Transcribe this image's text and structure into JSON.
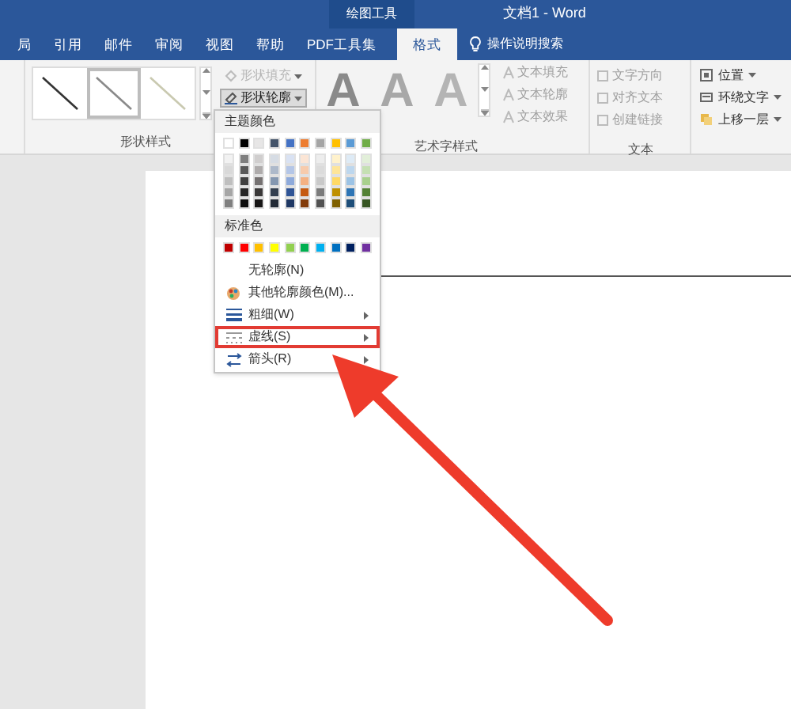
{
  "title_bar": {
    "context_tab": "绘图工具",
    "title": "文档1 - Word"
  },
  "tabs": [
    {
      "label": "局",
      "selected": false
    },
    {
      "label": "引用",
      "selected": false
    },
    {
      "label": "邮件",
      "selected": false
    },
    {
      "label": "审阅",
      "selected": false
    },
    {
      "label": "视图",
      "selected": false
    },
    {
      "label": "帮助",
      "selected": false
    },
    {
      "label": "PDF工具集",
      "selected": false
    },
    {
      "label": "格式",
      "selected": true
    }
  ],
  "tell_me": "操作说明搜索",
  "shape_styles": {
    "label": "形状样式",
    "thumbnails": [
      {
        "selected": false
      },
      {
        "selected": true
      },
      {
        "selected": false
      }
    ],
    "buttons": [
      {
        "label": "形状填充",
        "disabled": true,
        "active": false
      },
      {
        "label": "形状轮廓",
        "disabled": false,
        "active": true
      }
    ]
  },
  "wordart_styles": {
    "label": "艺术字样式",
    "letters": [
      "A",
      "A",
      "A"
    ],
    "buttons": [
      {
        "label": "文本填充"
      },
      {
        "label": "文本轮廓"
      },
      {
        "label": "文本效果"
      }
    ]
  },
  "text_group": {
    "label": "文本",
    "buttons": [
      {
        "label": "文字方向"
      },
      {
        "label": "对齐文本"
      },
      {
        "label": "创建链接"
      }
    ]
  },
  "arrange": [
    {
      "label": "位置"
    },
    {
      "label": "环绕文字"
    },
    {
      "label": "上移一层"
    }
  ],
  "outline_menu": {
    "theme_header": "主题颜色",
    "theme_rows": [
      [
        {
          "color": "#ffffff"
        },
        {
          "color": "#000000"
        },
        {
          "color": "#e7e6e6"
        },
        {
          "color": "#44546a"
        },
        {
          "color": "#4472c4"
        },
        {
          "color": "#ed7d31"
        },
        {
          "color": "#a5a5a5"
        },
        {
          "color": "#ffc000"
        },
        {
          "color": "#5b9bd5"
        },
        {
          "color": "#70ad47"
        }
      ],
      [
        {
          "color": "#f2f2f2"
        },
        {
          "color": "#7f7f7f"
        },
        {
          "color": "#d0cece"
        },
        {
          "color": "#d6dce4"
        },
        {
          "color": "#d9e2f3"
        },
        {
          "color": "#fbe5d5"
        },
        {
          "color": "#ededed"
        },
        {
          "color": "#fff2cc"
        },
        {
          "color": "#deebf6"
        },
        {
          "color": "#e2efd9"
        }
      ],
      [
        {
          "color": "#d9d9d9"
        },
        {
          "color": "#595959"
        },
        {
          "color": "#aeabab"
        },
        {
          "color": "#adb9ca"
        },
        {
          "color": "#b4c6e7"
        },
        {
          "color": "#f7cbac"
        },
        {
          "color": "#dbdbdb"
        },
        {
          "color": "#fee599"
        },
        {
          "color": "#bdd7ee"
        },
        {
          "color": "#c5e0b3"
        }
      ],
      [
        {
          "color": "#bfbfbf"
        },
        {
          "color": "#404040"
        },
        {
          "color": "#757171"
        },
        {
          "color": "#8497b0"
        },
        {
          "color": "#8eaadb"
        },
        {
          "color": "#f4b183"
        },
        {
          "color": "#c9c9c9"
        },
        {
          "color": "#ffd965"
        },
        {
          "color": "#9cc3e5"
        },
        {
          "color": "#a8d08d"
        }
      ],
      [
        {
          "color": "#a6a6a6"
        },
        {
          "color": "#262626"
        },
        {
          "color": "#3a3838"
        },
        {
          "color": "#333f4f"
        },
        {
          "color": "#2f5496"
        },
        {
          "color": "#c55a11"
        },
        {
          "color": "#7b7b7b"
        },
        {
          "color": "#bf9000"
        },
        {
          "color": "#2e75b5"
        },
        {
          "color": "#538135"
        }
      ],
      [
        {
          "color": "#808080"
        },
        {
          "color": "#0d0d0d"
        },
        {
          "color": "#171616"
        },
        {
          "color": "#222a35"
        },
        {
          "color": "#1f3864"
        },
        {
          "color": "#833c0b"
        },
        {
          "color": "#525252"
        },
        {
          "color": "#7f6000"
        },
        {
          "color": "#1e4e79"
        },
        {
          "color": "#375623"
        }
      ]
    ],
    "standard_header": "标准色",
    "standard_colors": [
      {
        "color": "#c00000"
      },
      {
        "color": "#ff0000"
      },
      {
        "color": "#ffc000"
      },
      {
        "color": "#ffff00"
      },
      {
        "color": "#92d050"
      },
      {
        "color": "#00b050"
      },
      {
        "color": "#00b0f0"
      },
      {
        "color": "#0070c0"
      },
      {
        "color": "#002060"
      },
      {
        "color": "#7030a0"
      }
    ],
    "items": [
      {
        "kind": "none",
        "label": "无轮廓(N)",
        "submenu": false,
        "highlighted": false
      },
      {
        "kind": "palette",
        "label": "其他轮廓颜色(M)...",
        "submenu": false,
        "highlighted": false
      },
      {
        "kind": "weight",
        "label": "粗细(W)",
        "submenu": true,
        "highlighted": false
      },
      {
        "kind": "dash",
        "label": "虚线(S)",
        "submenu": true,
        "highlighted": true
      },
      {
        "kind": "arrows",
        "label": "箭头(R)",
        "submenu": true,
        "highlighted": false
      }
    ]
  }
}
